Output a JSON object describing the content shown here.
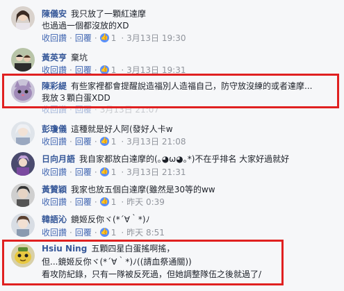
{
  "labels": {
    "retract": "收回讚",
    "reply": "回覆",
    "dot": "·"
  },
  "comments": [
    {
      "author": "陳儀安",
      "lines": [
        "我只放了一顆紅達摩",
        "也過過一個都沒放的XD"
      ],
      "likes": "1",
      "time": "3月13日 19:30"
    },
    {
      "author": "黃英亨",
      "lines": [
        "棄坑"
      ],
      "likes": "1",
      "time": "3月13日 19:31"
    },
    {
      "author": "陳彩緹",
      "lines": [
        "有些家裡都會提醒說造福別人造福自己，防守放沒練的或者達摩...",
        "我放３顆白蛋XDD"
      ],
      "likes": "",
      "time": "3月13日 21:07"
    },
    {
      "author": "彭瓊儀",
      "lines": [
        "這種就是好人阿(發好人卡w"
      ],
      "likes": "1",
      "time": "3月13日 21:08"
    },
    {
      "author": "日向月語",
      "lines": [
        "我自家都放白達摩的(｡◕ω◕｡*)不在乎排名 大家好過就好"
      ],
      "likes": "1",
      "time": "3月13日 21:31"
    },
    {
      "author": "黃贊穎",
      "lines": [
        "我家也放五個白達摩(雖然是30等的ww"
      ],
      "likes": "1",
      "time": "昨天 0:39"
    },
    {
      "author": "韓語沁",
      "lines": [
        "鏡姬反你ヾ(*´∀｀*)ﾉ"
      ],
      "likes": "1",
      "time": "昨天 8:51"
    },
    {
      "author": "Hsiu Ning",
      "lines": [
        "五顆四星白蛋搖啊搖，",
        "但...鏡姬反你ヾ(*´∀｀*)ﾉ((請血祭通關))",
        "看攻防紀錄，只有一隊被反死過，但她調整隊伍之後就過了/"
      ],
      "likes": "",
      "time": ""
    }
  ]
}
